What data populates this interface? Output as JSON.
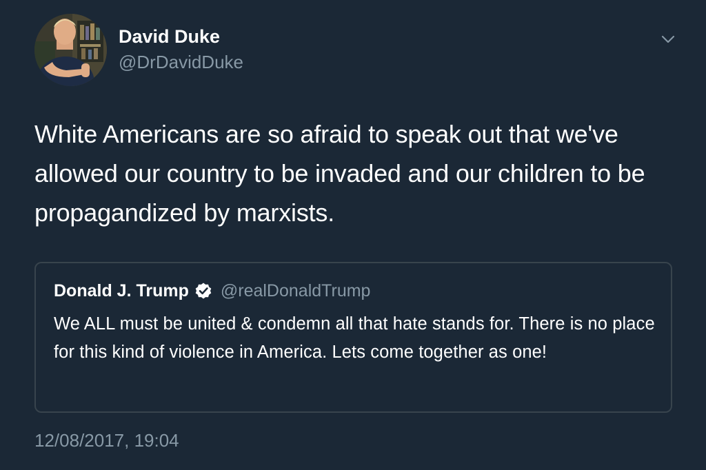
{
  "author": {
    "name": "David Duke",
    "handle": "@DrDavidDuke"
  },
  "tweet": {
    "text": "White Americans are so afraid to speak out that we've allowed our country to be invaded and our children to be propagandized by marxists.",
    "timestamp": "12/08/2017, 19:04"
  },
  "quoted_tweet": {
    "name": "Donald J. Trump",
    "handle": "@realDonaldTrump",
    "verified": true,
    "text": "We ALL must be united & condemn all that hate stands for. There is no place for this kind of violence in America. Lets come together as one!"
  },
  "icons": {
    "menu": "chevron-down-icon",
    "verified": "verified-badge-icon"
  },
  "colors": {
    "background": "#1b2836",
    "secondary_text": "#8899a6",
    "border": "#38444d"
  }
}
